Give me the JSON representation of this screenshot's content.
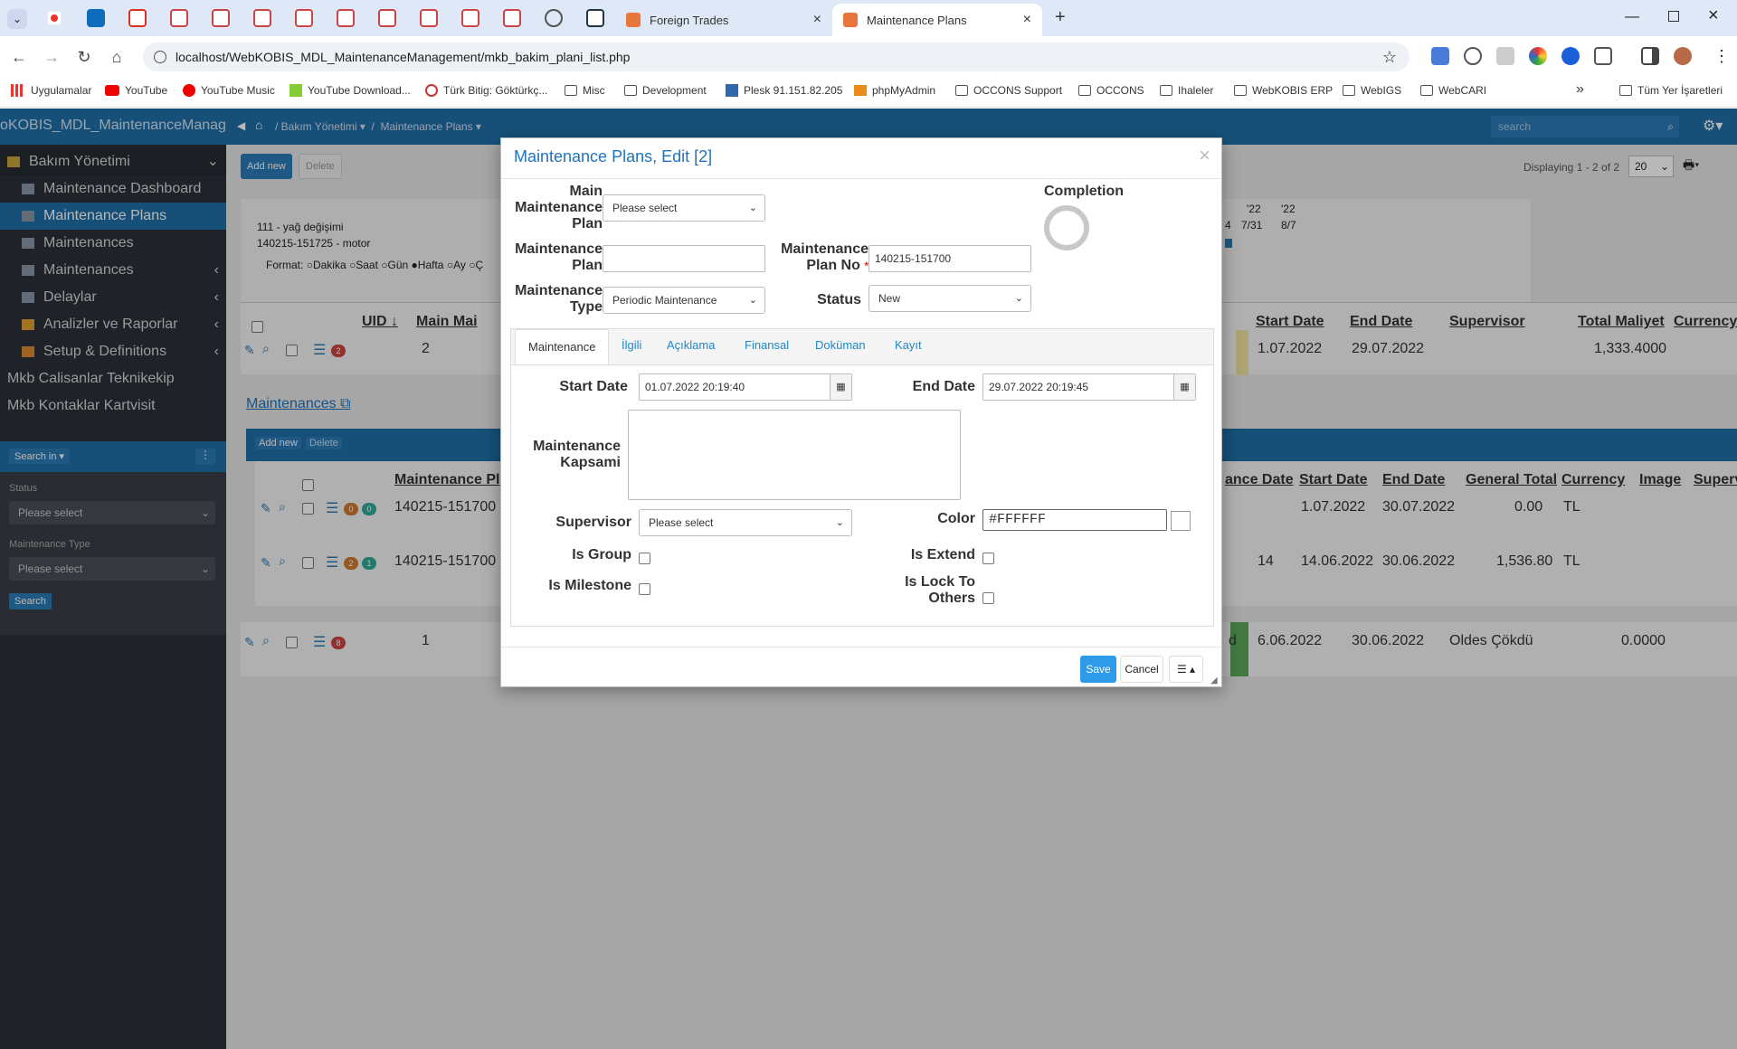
{
  "browser": {
    "tabs": [
      {
        "label": "Foreign Trades",
        "active": false
      },
      {
        "label": "Maintenance Plans",
        "active": true
      }
    ],
    "new_tab": "+",
    "url": "localhost/WebKOBIS_MDL_MaintenanceManagement/mkb_bakim_plani_list.php",
    "bookmarks": [
      "Uygulamalar",
      "YouTube",
      "YouTube Music",
      "YouTube Download...",
      "Türk Bitig: Göktürkç...",
      "Misc",
      "Development",
      "Plesk 91.151.82.205",
      "phpMyAdmin",
      "OCCONS Support",
      "OCCONS",
      "Ihaleler",
      "WebKOBIS ERP",
      "WebIGS",
      "WebCARI"
    ],
    "bookmarks_more": "»",
    "all_bookmarks": "Tüm Yer İşaretleri"
  },
  "app": {
    "title": "oKOBIS_MDL_MaintenanceManagem",
    "breadcrumb": [
      "Bakım Yönetimi ▾",
      "Maintenance Plans ▾"
    ],
    "search_placeholder": "search"
  },
  "sidebar": {
    "section": "Bakım Yönetimi",
    "items": [
      {
        "label": "Maintenance Dashboard",
        "active": false
      },
      {
        "label": "Maintenance Plans",
        "active": true
      },
      {
        "label": "Maintenances",
        "active": false
      },
      {
        "label": "Maintenances",
        "active": false
      },
      {
        "label": "Delaylar",
        "active": false
      },
      {
        "label": "Analizler ve Raporlar",
        "active": false
      },
      {
        "label": "Setup & Definitions",
        "active": false
      }
    ],
    "links": [
      "Mkb Calisanlar Teknikekip",
      "Mkb Kontaklar Kartvisit"
    ],
    "search_in": "Search in ▾",
    "filters": [
      {
        "label": "Status",
        "value": "Please select"
      },
      {
        "label": "Maintenance Type",
        "value": "Please select"
      }
    ],
    "search_button": "Search"
  },
  "background": {
    "add_new": "Add new",
    "delete": "Delete",
    "displaying": "Displaying 1 - 2 of 2",
    "page_size": "20",
    "gantt_rows": [
      "111 - yağ değişimi",
      "140215-151725 - motor"
    ],
    "format_label": "Format:",
    "format_options": [
      "Dakika",
      "Saat",
      "Gün",
      "Hafta",
      "Ay",
      "Ç"
    ],
    "gantt_head": [
      "'22",
      "'22",
      "7/31",
      "8/7",
      "4"
    ],
    "table_headers": [
      "UID",
      "Main Mai",
      "Start Date",
      "End Date",
      "Supervisor",
      "Total Maliyet",
      "Currency"
    ],
    "row1": {
      "uid": "2",
      "badge": "2",
      "start": "1.07.2022",
      "end": "29.07.2022",
      "total": "1,333.4000"
    },
    "sub_title": "Maintenances",
    "sub_add": "Add new",
    "sub_delete": "Delete",
    "sub_headers": [
      "Maintenance Pl",
      "ance Date",
      "Start Date",
      "End Date",
      "General Total",
      "Currency",
      "Image",
      "Superv"
    ],
    "sub_rows": [
      {
        "plan": "140215-151700",
        "b1": "0",
        "b2": "0",
        "start": "1.07.2022",
        "end": "30.07.2022",
        "total": "0.00",
        "cur": "TL",
        "extra": ""
      },
      {
        "plan": "140215-151700",
        "b1": "2",
        "b2": "1",
        "start": "14.06.2022",
        "end": "30.06.2022",
        "total": "1,536.80",
        "cur": "TL",
        "extra": "14"
      }
    ],
    "row2": {
      "uid": "1",
      "badge": "8",
      "start": "6.06.2022",
      "end": "30.06.2022",
      "supervisor": "Oldes Çökdü",
      "total": "0.0000",
      "extra": "d"
    }
  },
  "modal": {
    "title": "Maintenance Plans, Edit [2]",
    "close": "×",
    "main_plan_label": "Main Maintenance Plan",
    "main_plan_value": "Please select",
    "plan_label": "Maintenance Plan",
    "plan_value": "",
    "plan_no_label": "Maintenance Plan No",
    "plan_no_value": "140215-151700",
    "type_label": "Maintenance Type",
    "type_value": "Periodic Maintenance",
    "status_label": "Status",
    "status_value": "New",
    "completion_label": "Completion",
    "tabs": [
      "Maintenance",
      "İlgili",
      "Açıklama",
      "Finansal",
      "Doküman",
      "Kayıt"
    ],
    "start_label": "Start Date",
    "start_value": "01.07.2022 20:19:40",
    "end_label": "End Date",
    "end_value": "29.07.2022 20:19:45",
    "scope_label": "Maintenance Kapsami",
    "scope_value": "",
    "supervisor_label": "Supervisor",
    "supervisor_value": "Please select",
    "color_label": "Color",
    "color_value": "#FFFFFF",
    "is_group": "Is Group",
    "is_milestone": "Is Milestone",
    "is_extend": "Is Extend",
    "is_lock": "Is Lock To Others",
    "save": "Save",
    "cancel": "Cancel",
    "menu": "☰ ▴"
  },
  "colors": {
    "accent": "#1f6fa8",
    "save": "#2d9bea",
    "sidebar": "#2c3038",
    "active_item": "#1f6fa8"
  }
}
